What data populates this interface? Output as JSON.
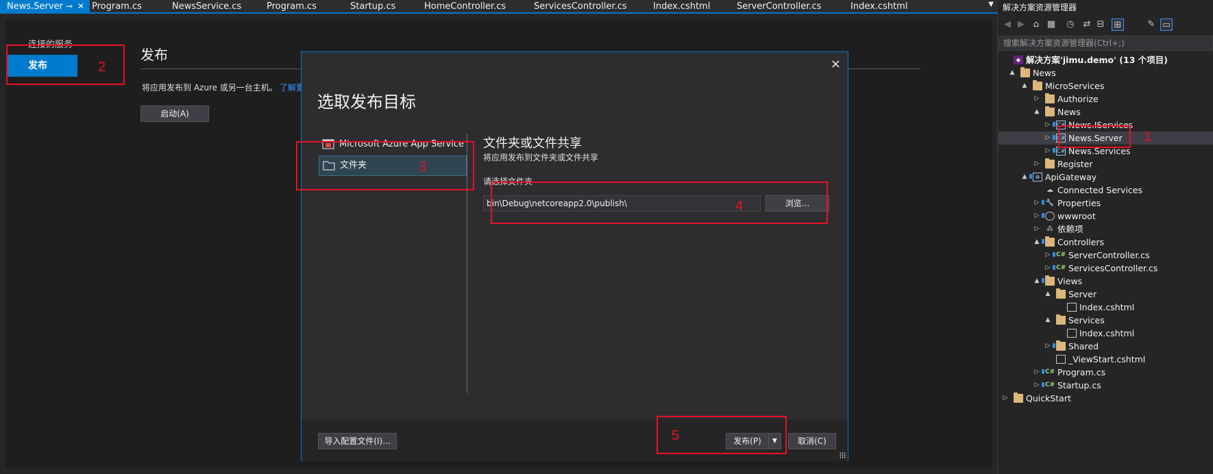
{
  "tabs": [
    {
      "label": "News.Server",
      "active": true
    },
    {
      "label": "Program.cs"
    },
    {
      "label": "NewsService.cs"
    },
    {
      "label": "Program.cs"
    },
    {
      "label": "Startup.cs"
    },
    {
      "label": "HomeController.cs"
    },
    {
      "label": "ServicesController.cs"
    },
    {
      "label": "Index.cshtml"
    },
    {
      "label": "ServerController.cs"
    },
    {
      "label": "Index.cshtml"
    }
  ],
  "publish_page": {
    "connected_services_label": "连接的服务",
    "publish_nav_label": "发布",
    "heading": "发布",
    "description": "将应用发布到 Azure 或另一台主机。",
    "learn_more": "了解更多",
    "start_button": "启动(A)"
  },
  "dialog": {
    "title": "选取发布目标",
    "close_glyph": "×",
    "targets": [
      {
        "label": "Microsoft Azure App Service"
      },
      {
        "label": "文件夹",
        "selected": true
      }
    ],
    "option_heading": "文件夹或文件共享",
    "option_description": "将应用发布到文件夹或文件共享",
    "folder_label": "请选择文件夹",
    "folder_path": "bin\\Debug\\netcoreapp2.0\\publish\\",
    "browse_button": "浏览...",
    "import_button": "导入配置文件(I)...",
    "publish_button": "发布(P)",
    "publish_dropdown_glyph": "▼",
    "cancel_button": "取消(C)"
  },
  "explorer": {
    "title": "解决方案资源管理器",
    "search_placeholder": "搜索解决方案资源管理器(Ctrl+;)",
    "tree": [
      {
        "label": "解决方案'jimu.demo' (13 个项目)",
        "icon": "solution-icon",
        "bold": true
      },
      {
        "label": "News",
        "icon": "folder-icon",
        "arrow": "▲"
      },
      {
        "label": "MicroServices",
        "icon": "folder-icon",
        "arrow": "▲"
      },
      {
        "label": "Authorize",
        "icon": "folder-icon",
        "arrow": "▷"
      },
      {
        "label": "News",
        "icon": "folder-icon",
        "arrow": "▲"
      },
      {
        "label": "News.IServices",
        "icon": "csproj-icon",
        "arrow": "▷"
      },
      {
        "label": "News.Server",
        "icon": "csproj-icon",
        "arrow": "▷",
        "selected": true
      },
      {
        "label": "News.Services",
        "icon": "csproj-icon",
        "arrow": "▷"
      },
      {
        "label": "Register",
        "icon": "folder-icon",
        "arrow": "▷"
      },
      {
        "label": "ApiGateway",
        "icon": "webproj-icon",
        "arrow": "▲"
      },
      {
        "label": "Connected Services",
        "icon": "cloud-icon"
      },
      {
        "label": "Properties",
        "icon": "wrench-icon",
        "arrow": "▷"
      },
      {
        "label": "wwwroot",
        "icon": "globe-icon",
        "arrow": "▷"
      },
      {
        "label": "依赖项",
        "icon": "dependencies-icon",
        "arrow": "▷"
      },
      {
        "label": "Controllers",
        "icon": "folder-icon",
        "arrow": "▲"
      },
      {
        "label": "ServerController.cs",
        "icon": "csharp-file-icon",
        "arrow": "▷"
      },
      {
        "label": "ServicesController.cs",
        "icon": "csharp-file-icon",
        "arrow": "▷"
      },
      {
        "label": "Views",
        "icon": "folder-icon",
        "arrow": "▲"
      },
      {
        "label": "Server",
        "icon": "folder-icon",
        "arrow": "▲"
      },
      {
        "label": "Index.cshtml",
        "icon": "cshtml-file-icon"
      },
      {
        "label": "Services",
        "icon": "folder-icon",
        "arrow": "▲"
      },
      {
        "label": "Index.cshtml",
        "icon": "cshtml-file-icon"
      },
      {
        "label": "Shared",
        "icon": "folder-icon",
        "arrow": "▷"
      },
      {
        "label": "_ViewStart.cshtml",
        "icon": "cshtml-file-icon"
      },
      {
        "label": "Program.cs",
        "icon": "csharp-file-icon",
        "arrow": "▷"
      },
      {
        "label": "Startup.cs",
        "icon": "csharp-file-icon",
        "arrow": "▷"
      },
      {
        "label": "QuickStart",
        "icon": "folder-icon",
        "arrow": "▷"
      }
    ]
  },
  "annotations": [
    "1",
    "2",
    "3",
    "4",
    "5"
  ],
  "colors": {
    "accent": "#007acc",
    "annotation": "#e81123",
    "background": "#252526"
  }
}
